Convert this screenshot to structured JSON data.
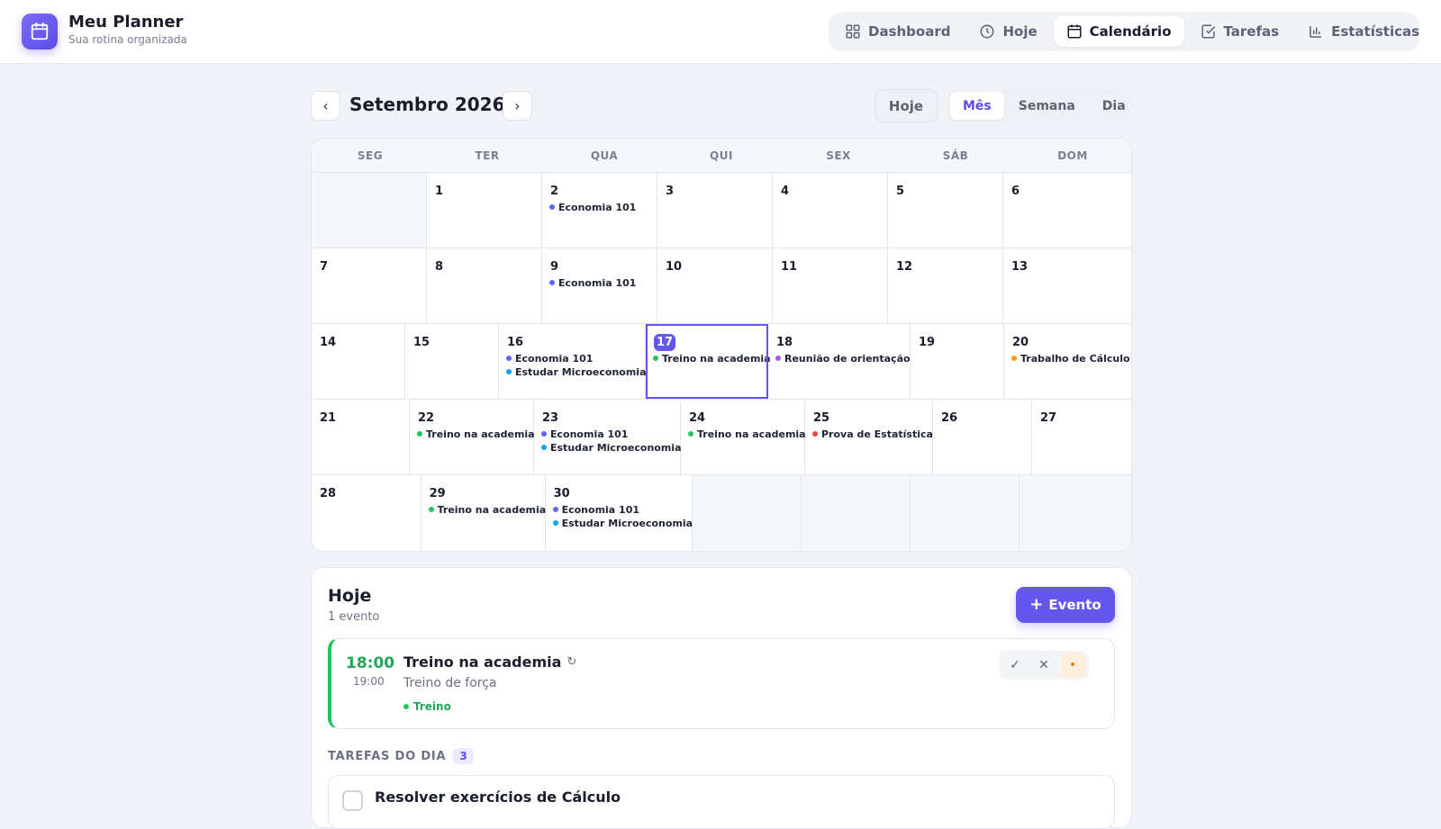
{
  "brand": {
    "title": "Meu Planner",
    "subtitle": "Sua rotina organizada"
  },
  "nav": {
    "items": [
      {
        "label": "Dashboard",
        "icon": "grid-icon"
      },
      {
        "label": "Hoje",
        "icon": "clock-icon"
      },
      {
        "label": "Calendário",
        "icon": "calendar-icon",
        "active": true
      },
      {
        "label": "Tarefas",
        "icon": "checkbox-icon"
      },
      {
        "label": "Estatísticas",
        "icon": "bar-chart-icon"
      }
    ]
  },
  "toolbar": {
    "month_title": "Setembro 2026",
    "today_label": "Hoje",
    "views": [
      "Mês",
      "Semana",
      "Dia"
    ],
    "active_view": "Mês"
  },
  "colors": {
    "accent": "#6357f0",
    "aula": "#6366f1",
    "estudo": "#0ea5e9",
    "treino": "#22c55e",
    "reuniao": "#a855f7",
    "trabalho": "#f59e0b",
    "prova": "#ef4444"
  },
  "calendar": {
    "weekdays": [
      "SEG",
      "TER",
      "QUA",
      "QUI",
      "SEX",
      "SÁB",
      "DOM"
    ],
    "weeks": [
      [
        {
          "day": "",
          "events": []
        },
        {
          "day": "1",
          "events": []
        },
        {
          "day": "2",
          "events": [
            {
              "label": "Economia 101",
              "color": "#6366f1"
            }
          ]
        },
        {
          "day": "3",
          "events": []
        },
        {
          "day": "4",
          "events": []
        },
        {
          "day": "5",
          "events": []
        },
        {
          "day": "6",
          "events": []
        }
      ],
      [
        {
          "day": "7",
          "events": []
        },
        {
          "day": "8",
          "events": []
        },
        {
          "day": "9",
          "events": [
            {
              "label": "Economia 101",
              "color": "#6366f1"
            }
          ]
        },
        {
          "day": "10",
          "events": []
        },
        {
          "day": "11",
          "events": []
        },
        {
          "day": "12",
          "events": []
        },
        {
          "day": "13",
          "events": []
        }
      ],
      [
        {
          "day": "14",
          "events": []
        },
        {
          "day": "15",
          "events": []
        },
        {
          "day": "16",
          "events": [
            {
              "label": "Economia 101",
              "color": "#6366f1"
            },
            {
              "label": "Estudar Microeconomia",
              "color": "#0ea5e9"
            }
          ]
        },
        {
          "day": "17",
          "today": true,
          "events": [
            {
              "label": "Treino na academia",
              "color": "#22c55e"
            }
          ]
        },
        {
          "day": "18",
          "events": [
            {
              "label": "Reunião de orientação",
              "color": "#a855f7"
            }
          ]
        },
        {
          "day": "19",
          "events": []
        },
        {
          "day": "20",
          "events": [
            {
              "label": "Trabalho de Cálculo",
              "color": "#f59e0b"
            }
          ]
        }
      ],
      [
        {
          "day": "21",
          "events": []
        },
        {
          "day": "22",
          "events": [
            {
              "label": "Treino na academia",
              "color": "#22c55e"
            }
          ]
        },
        {
          "day": "23",
          "events": [
            {
              "label": "Economia 101",
              "color": "#6366f1"
            },
            {
              "label": "Estudar Microeconomia",
              "color": "#0ea5e9"
            }
          ]
        },
        {
          "day": "24",
          "events": [
            {
              "label": "Treino na academia",
              "color": "#22c55e"
            }
          ]
        },
        {
          "day": "25",
          "events": [
            {
              "label": "Prova de Estatística",
              "color": "#ef4444"
            }
          ]
        },
        {
          "day": "26",
          "events": []
        },
        {
          "day": "27",
          "events": []
        }
      ],
      [
        {
          "day": "28",
          "events": []
        },
        {
          "day": "29",
          "events": [
            {
              "label": "Treino na academia",
              "color": "#22c55e"
            }
          ]
        },
        {
          "day": "30",
          "events": [
            {
              "label": "Economia 101",
              "color": "#6366f1"
            },
            {
              "label": "Estudar Microeconomia",
              "color": "#0ea5e9"
            }
          ]
        },
        {
          "day": "",
          "events": []
        },
        {
          "day": "",
          "events": []
        },
        {
          "day": "",
          "events": []
        },
        {
          "day": "",
          "events": []
        }
      ]
    ]
  },
  "today_panel": {
    "title": "Hoje",
    "count": "1 evento",
    "add_label": "Evento",
    "event": {
      "start": "18:00",
      "end": "19:00",
      "title": "Treino na academia",
      "description": "Treino de força",
      "tag": "Treino",
      "repeat_glyph": "↻",
      "actions": [
        "✓",
        "✕",
        "•"
      ]
    },
    "tasks_label": "TAREFAS DO DIA",
    "tasks_count": "3",
    "first_task": "Resolver exercícios de Cálculo"
  }
}
